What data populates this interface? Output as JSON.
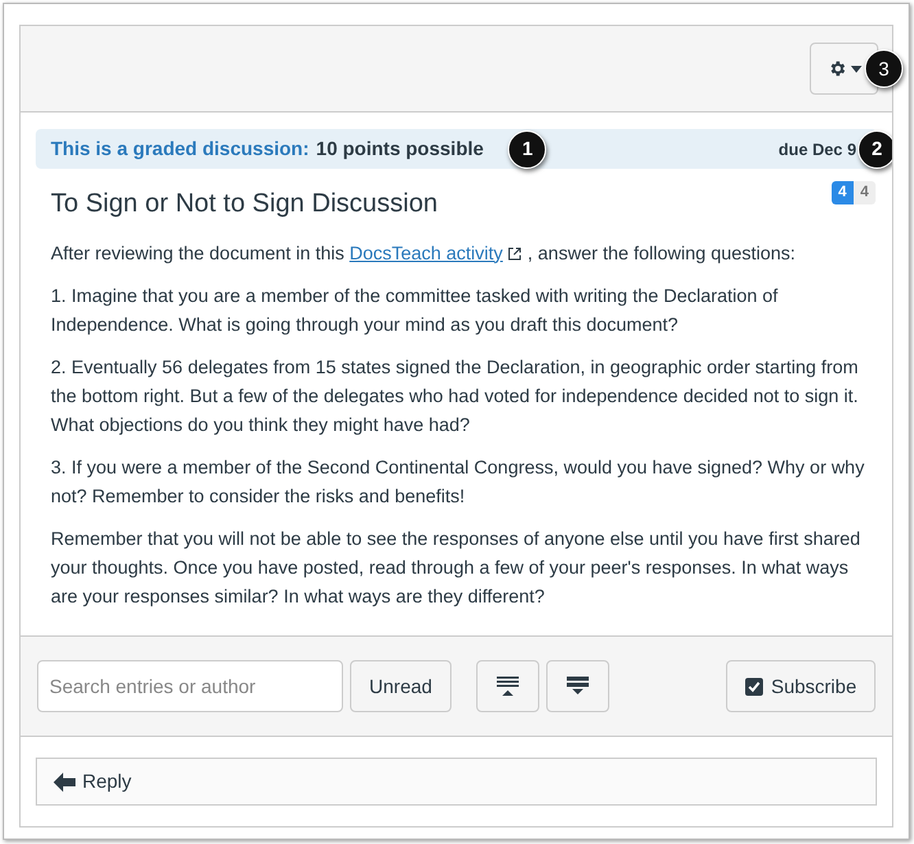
{
  "graded_banner": {
    "label": "This is a graded discussion:",
    "points": "10 points possible",
    "due": "due Dec 9"
  },
  "title": "To Sign or Not to Sign Discussion",
  "badges": {
    "unread": "4",
    "total": "4"
  },
  "intro": {
    "before": "After reviewing the document in this",
    "link": "DocsTeach activity",
    "after": ", answer the following questions:"
  },
  "paragraphs": [
    "1. Imagine that you are a member of the committee tasked with writing the Declaration of Independence. What is going through your mind as you draft this document?",
    "2. Eventually 56 delegates from 15 states signed the Declaration, in geographic order starting from the bottom right. But a few of the delegates who had voted for independence decided not to sign it. What objections do you think they might have had?",
    "3. If you were a member of the Second Continental Congress, would you have signed? Why or why not? Remember to consider the risks and benefits!",
    "Remember that you will not be able to see the responses of anyone else until you have first shared your thoughts. Once you have posted, read through a few of your peer's responses. In what ways are your responses similar? In what ways are they different?"
  ],
  "toolbar": {
    "search": {
      "placeholder": "Search entries or author"
    },
    "unread_button": "Unread",
    "subscribe_button": "Subscribe"
  },
  "reply_button": "Reply",
  "callouts": [
    "1",
    "2",
    "3"
  ]
}
